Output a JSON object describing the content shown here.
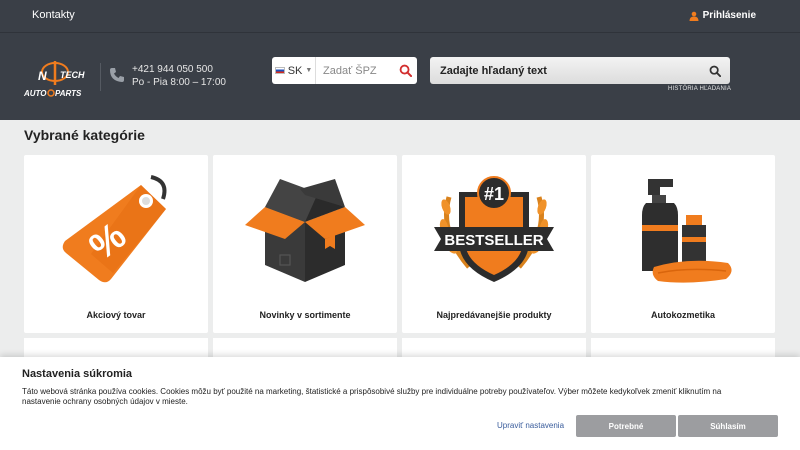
{
  "topbar": {
    "contacts": "Kontakty",
    "login": "Prihlásenie"
  },
  "header": {
    "phone": "+421 944 050 500",
    "hours": "Po - Pia 8:00 – 17:00",
    "spz": {
      "country": "SK",
      "placeholder": "Zadať ŠPZ"
    },
    "search": {
      "placeholder": "Zadajte hľadaný text",
      "history": "HISTÓRIA HĽADANIA"
    },
    "logo_text": [
      "N",
      "TECH",
      "AUTO",
      "PARTS"
    ]
  },
  "main": {
    "section_title": "Vybrané kategórie",
    "categories": [
      {
        "label": "Akciový tovar",
        "icon": "percent-tag-icon"
      },
      {
        "label": "Novinky v sortimente",
        "icon": "open-box-icon"
      },
      {
        "label": "Najpredávanejšie produkty",
        "icon": "bestseller-badge-icon",
        "badge_number": "#1",
        "badge_text": "BESTSELLER"
      },
      {
        "label": "Autokozmetika",
        "icon": "cosmetics-bottles-icon"
      }
    ]
  },
  "cookie": {
    "title": "Nastavenia súkromia",
    "text": "Táto webová stránka používa cookies. Cookies môžu byť použité na marketing, štatistické a prispôsobivé služby pre individuálne potreby používateľov. Výber môžete kedykoľvek zmeniť kliknutím na nastavenie ochrany osobných údajov v mieste.",
    "edit_label": "Upraviť nastavenia",
    "needed_label": "Potrebné",
    "agree_label": "Súhlasím"
  },
  "colors": {
    "header_bg": "#3a3f47",
    "accent": "#f07c1e",
    "search_red": "#d32f2f",
    "button_gray": "#9c9da0"
  }
}
